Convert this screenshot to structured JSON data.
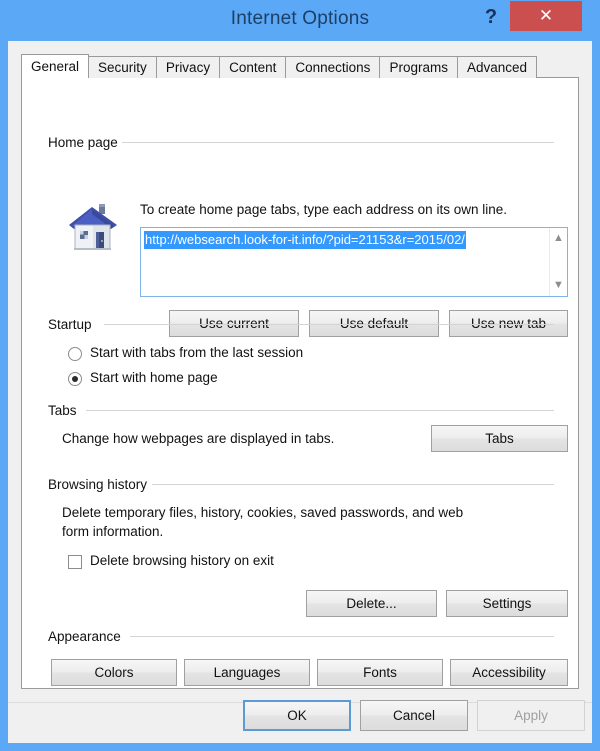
{
  "window": {
    "title": "Internet Options",
    "help_label": "?",
    "close_label": "✕",
    "accent_blue": "#5BA8F7",
    "close_red": "#cc4f4f"
  },
  "tabs": [
    {
      "label": "General",
      "active": true
    },
    {
      "label": "Security",
      "active": false
    },
    {
      "label": "Privacy",
      "active": false
    },
    {
      "label": "Content",
      "active": false
    },
    {
      "label": "Connections",
      "active": false
    },
    {
      "label": "Programs",
      "active": false
    },
    {
      "label": "Advanced",
      "active": false
    }
  ],
  "home_page": {
    "group_label": "Home page",
    "description": "To create home page tabs, type each address on its own line.",
    "url_value": "http://websearch.look-for-it.info/?pid=21153&r=2015/02/",
    "selection_color": "#3399ff",
    "buttons": {
      "use_current": "Use current",
      "use_default": "Use default",
      "use_new_tab": "Use new tab"
    }
  },
  "startup": {
    "group_label": "Startup",
    "options": [
      {
        "label": "Start with tabs from the last session",
        "selected": false
      },
      {
        "label": "Start with home page",
        "selected": true
      }
    ]
  },
  "tabs_section": {
    "group_label": "Tabs",
    "description": "Change how webpages are displayed in tabs.",
    "button_label": "Tabs"
  },
  "browsing_history": {
    "group_label": "Browsing history",
    "description_line1": "Delete temporary files, history, cookies, saved passwords, and web",
    "description_line2": "form information.",
    "checkbox_label": "Delete browsing history on exit",
    "checkbox_checked": false,
    "buttons": {
      "delete": "Delete...",
      "settings": "Settings"
    }
  },
  "appearance": {
    "group_label": "Appearance",
    "buttons": {
      "colors": "Colors",
      "languages": "Languages",
      "fonts": "Fonts",
      "accessibility": "Accessibility"
    }
  },
  "footer": {
    "ok": "OK",
    "cancel": "Cancel",
    "apply": "Apply",
    "apply_disabled": true
  }
}
